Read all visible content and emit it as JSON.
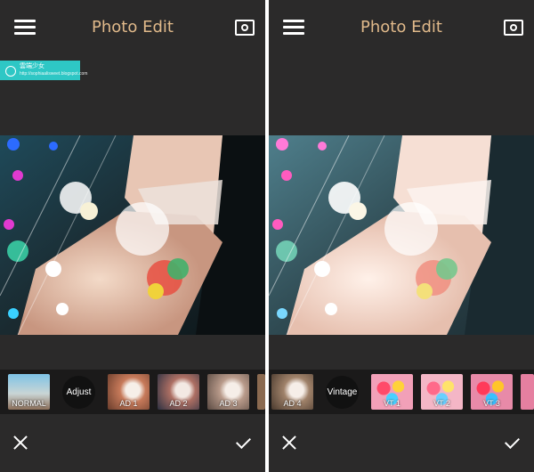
{
  "left": {
    "title": "Photo Edit",
    "watermark_text": "雲端少女",
    "watermark_url": "http://sophiaalisweet.blogspot.com",
    "filters": [
      {
        "label": "NORMAL",
        "kind": "thumb"
      },
      {
        "label": "Adjust",
        "kind": "button"
      },
      {
        "label": "AD 1",
        "kind": "thumb"
      },
      {
        "label": "AD 2",
        "kind": "thumb"
      },
      {
        "label": "AD 3",
        "kind": "thumb"
      }
    ]
  },
  "right": {
    "title": "Photo Edit",
    "filters": [
      {
        "label": "AD 4",
        "kind": "thumb"
      },
      {
        "label": "Vintage",
        "kind": "button"
      },
      {
        "label": "VT 1",
        "kind": "thumb"
      },
      {
        "label": "VT 2",
        "kind": "thumb"
      },
      {
        "label": "VT 3",
        "kind": "thumb"
      }
    ]
  },
  "icons": {
    "menu": "hamburger-icon",
    "compare": "compare-icon",
    "cancel": "close-icon",
    "confirm": "checkmark-icon"
  },
  "colors": {
    "background": "#2b2a2a",
    "title": "#e0b98a",
    "strip": "#1b1a1a",
    "watermark": "#2ec7c5"
  }
}
